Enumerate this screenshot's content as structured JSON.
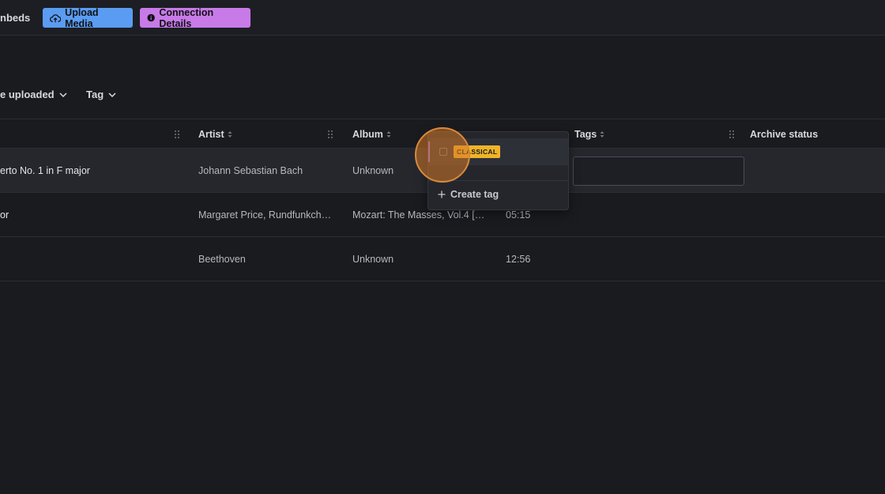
{
  "topbar": {
    "partial_label": "nbeds",
    "upload_label": "Upload Media",
    "connection_label": "Connection Details"
  },
  "filters": [
    {
      "label": "e uploaded"
    },
    {
      "label": "Tag"
    }
  ],
  "table": {
    "columns": [
      "Artist",
      "Album",
      "Tags",
      "Archive status"
    ],
    "rows": [
      {
        "title": "erto No. 1 in F major",
        "artist": "Johann Sebastian Bach",
        "album": "Unknown",
        "duration": ""
      },
      {
        "title": "or",
        "artist": "Margaret Price, Rundfunkchor...",
        "album": "Mozart: The Masses, Vol.4 [Dis...",
        "duration": "05:15"
      },
      {
        "title": "",
        "artist": "Beethoven",
        "album": "Unknown",
        "duration": "12:56"
      }
    ]
  },
  "tag_dropdown": {
    "option_label": "CLASSICAL",
    "create_label": "Create tag"
  },
  "colors": {
    "upload_button": "#5a9cf2",
    "connection_button": "#c77ae8",
    "tag_badge": "#f0b429"
  }
}
